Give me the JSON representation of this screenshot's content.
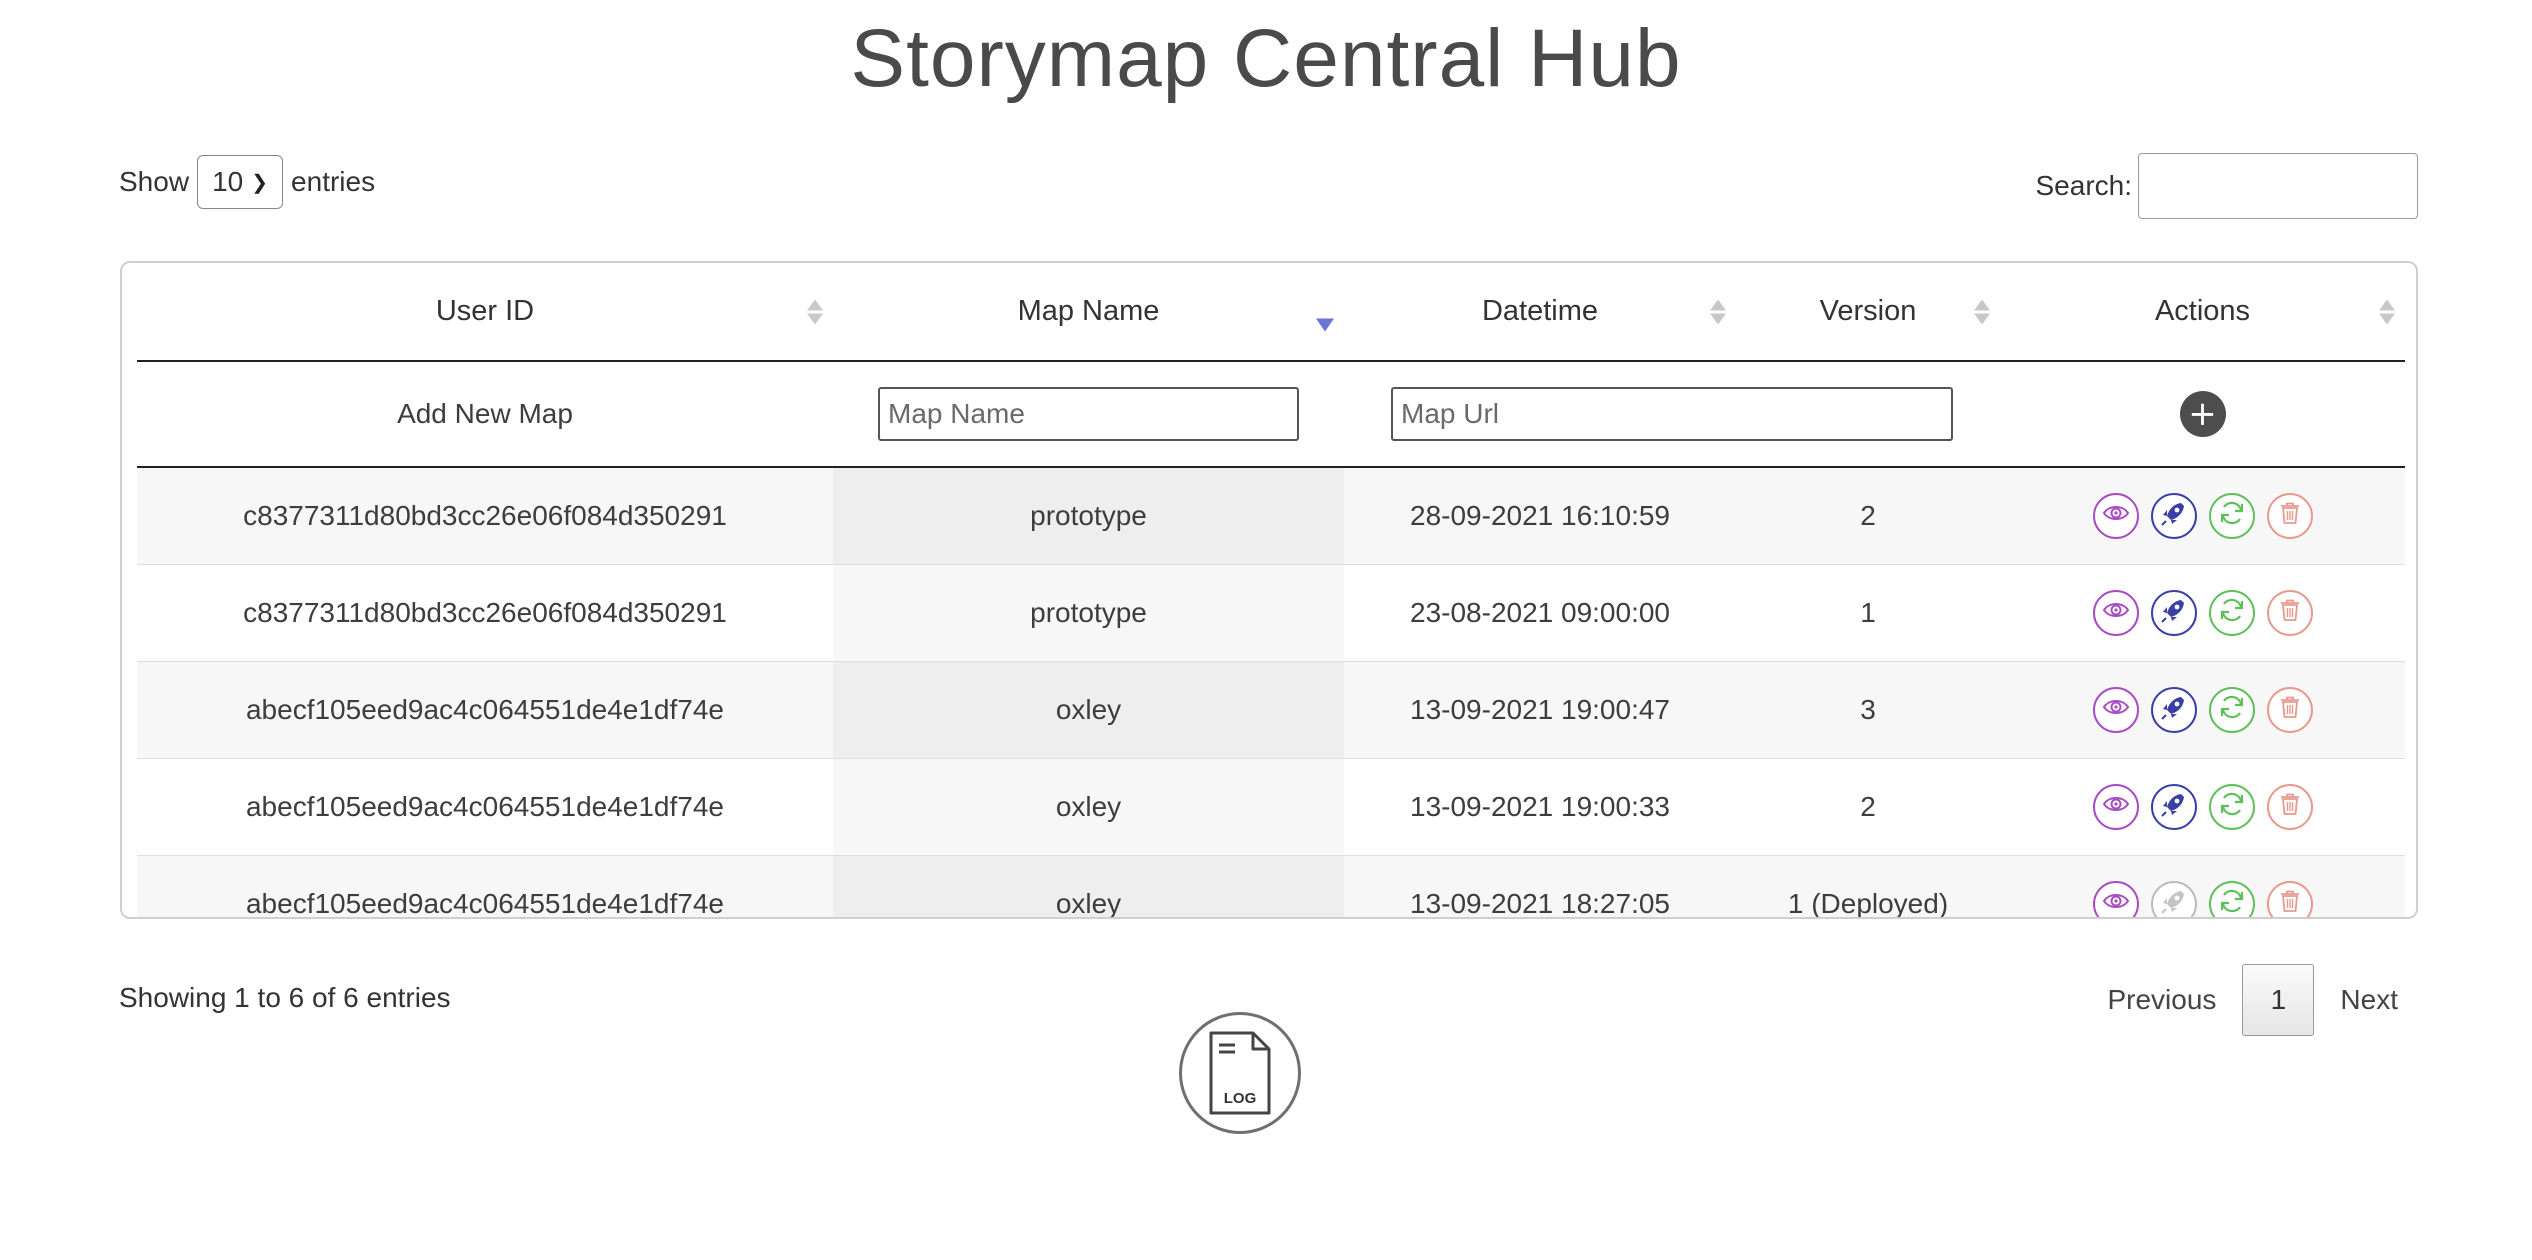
{
  "page": {
    "title": "Storymap Central Hub"
  },
  "length_control": {
    "show_label": "Show",
    "value": "10",
    "entries_label": "entries"
  },
  "search": {
    "label": "Search:",
    "value": ""
  },
  "table": {
    "columns": [
      "User ID",
      "Map Name",
      "Datetime",
      "Version",
      "Actions"
    ],
    "sorted_column": "Map Name",
    "add_row": {
      "label": "Add New Map",
      "map_name_placeholder": "Map Name",
      "map_url_placeholder": "Map Url",
      "add_button_icon": "plus-icon"
    },
    "rows": [
      {
        "user_id": "c8377311d80bd3cc26e06f084d350291",
        "map_name": "prototype",
        "datetime": "28-09-2021 16:10:59",
        "version": "2",
        "deployed": false
      },
      {
        "user_id": "c8377311d80bd3cc26e06f084d350291",
        "map_name": "prototype",
        "datetime": "23-08-2021 09:00:00",
        "version": "1",
        "deployed": false
      },
      {
        "user_id": "abecf105eed9ac4c064551de4e1df74e",
        "map_name": "oxley",
        "datetime": "13-09-2021 19:00:47",
        "version": "3",
        "deployed": false
      },
      {
        "user_id": "abecf105eed9ac4c064551de4e1df74e",
        "map_name": "oxley",
        "datetime": "13-09-2021 19:00:33",
        "version": "2",
        "deployed": false
      },
      {
        "user_id": "abecf105eed9ac4c064551de4e1df74e",
        "map_name": "oxley",
        "datetime": "13-09-2021 18:27:05",
        "version": "1 (Deployed)",
        "deployed": true
      }
    ],
    "action_icons": [
      "eye-icon",
      "rocket-icon",
      "refresh-icon",
      "trash-icon"
    ]
  },
  "info": "Showing 1 to 6 of 6 entries",
  "pagination": {
    "previous": "Previous",
    "current": "1",
    "next": "Next"
  },
  "log_button": {
    "label": "LOG"
  },
  "colors": {
    "view": "#a84cc4",
    "deploy": "#3a3fa8",
    "sync": "#5fbf5a",
    "delete": "#e89a8e",
    "sort_active": "#6b74d6"
  }
}
